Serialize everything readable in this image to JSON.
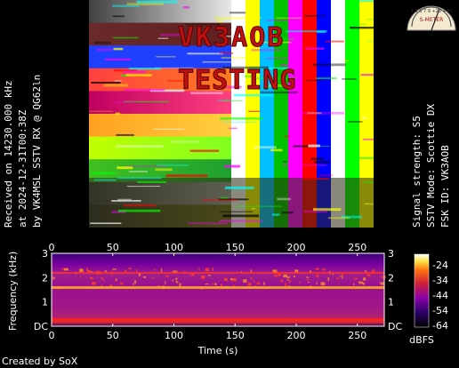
{
  "left_info": {
    "line1": "Received on  14230.000 kHz",
    "line2": "at 2024-12-31T00:38Z",
    "line3": "by VK4MSL SSTV RX @ QG62ln"
  },
  "right_info": {
    "line1": "Signal strength: S5",
    "line2": "SSTV Mode: Scottie DX",
    "line3": "FSK ID: VK3AOB"
  },
  "sstv_image": {
    "callsign_text": "VK3AOB",
    "overlay_text": "TESTING",
    "text_color": "#c01010"
  },
  "spectrogram": {
    "ylabel": "Frequency (kHz)",
    "xlabel": "Time (s)",
    "x_ticks": [
      "0",
      "50",
      "100",
      "150",
      "200",
      "250"
    ],
    "y_ticks": [
      "3",
      "2",
      "1",
      "DC"
    ],
    "colorbar_ticks": [
      "-24",
      "-34",
      "-44",
      "-54",
      "-64"
    ],
    "colorbar_unit": "dBFS",
    "x_range": [
      0,
      272
    ],
    "colors": [
      "#000000",
      "#2a0066",
      "#8a00a8",
      "#d0203a",
      "#ff7010",
      "#ffe040",
      "#ffffff"
    ]
  },
  "smeter": {
    "label": "S-METER",
    "scale": "1 3 5 7 9 +20 +40"
  },
  "credit": "Created by SoX"
}
